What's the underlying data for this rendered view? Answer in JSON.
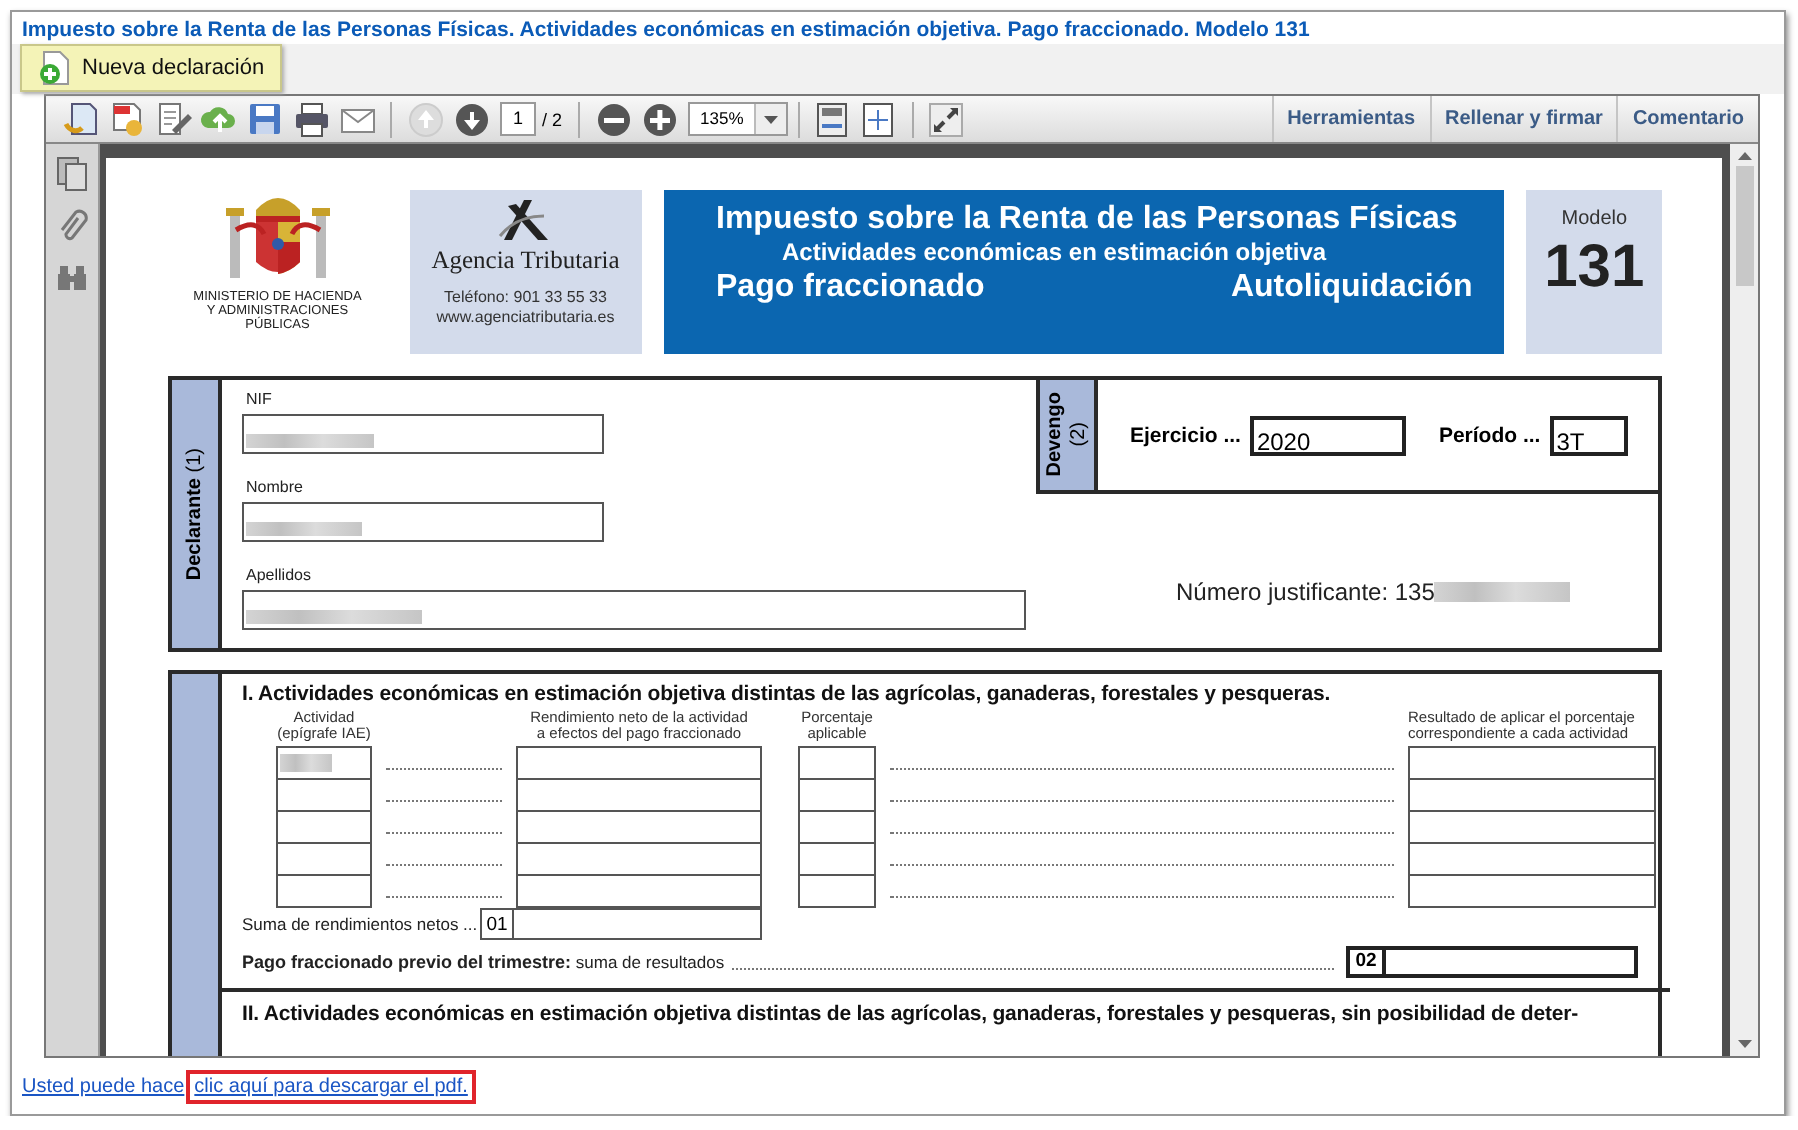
{
  "window": {
    "title": "Impuesto sobre la Renta de las Personas Físicas. Actividades económicas en estimación objetiva. Pago fraccionado. Modelo 131"
  },
  "tooltip_button": {
    "label": "Nueva declaración"
  },
  "toolbar": {
    "page": "1",
    "page_total": "/ 2",
    "zoom": "135%",
    "panels": [
      "Herramientas",
      "Rellenar y firmar",
      "Comentario"
    ]
  },
  "document": {
    "header": {
      "ministry_lines": [
        "MINISTERIO DE HACIENDA",
        "Y ADMINISTRACIONES",
        "PÚBLICAS"
      ],
      "agency": "Agencia Tributaria",
      "phone": "Teléfono: 901 33 55 33",
      "web": "www.agenciatributaria.es",
      "banner_title": "Impuesto sobre la Renta de las Personas Físicas",
      "banner_subtitle": "Actividades económicas en estimación objetiva",
      "banner_left": "Pago fraccionado",
      "banner_right": "Autoliquidación",
      "model_label": "Modelo",
      "model_number": "131"
    },
    "declarante": {
      "label": "**Declarante** (1)",
      "fields": [
        {
          "label": "NIF",
          "redacted": true
        },
        {
          "label": "Nombre",
          "redacted": true
        },
        {
          "label": "Apellidos",
          "redacted": true
        }
      ],
      "devengo": {
        "label": "Devengo",
        "note": "(2)",
        "ejercicio_label": "Ejercicio ...",
        "ejercicio": "2020",
        "periodo_label": "Período ...",
        "periodo": "3T"
      },
      "justificante_label": "Número justificante: 135",
      "justificante_redacted": true
    },
    "section_1": {
      "title": "I.  Actividades económicas en estimación objetiva distintas de las agrícolas, ganaderas, forestales y pesqueras.",
      "col_activity": "Actividad\n(epígrafe IAE)",
      "col_rendimiento": "Rendimiento neto de la actividad\na efectos del pago fraccionado",
      "col_porcentaje": "Porcentaje\naplicable",
      "col_resultado": "Resultado de aplicar el porcentaje\ncorrespondiente a cada actividad",
      "rows": [
        {
          "redacted": true
        },
        {
          "redacted": false
        },
        {
          "redacted": false
        },
        {
          "redacted": false
        },
        {
          "redacted": false
        }
      ],
      "suma_label": "Suma de rendimientos netos ...",
      "suma_box": "01",
      "previo_label": "**Pago fraccionado previo del trimestre:** suma de resultados",
      "previo_box": "02"
    },
    "section_2": {
      "title": "II.  Actividades económicas en estimación objetiva distintas de las agrícolas, ganaderas, forestales y pesqueras, sin posibilidad de deter-"
    }
  },
  "footer": {
    "text": "Usted puede hace",
    "link": "clic aquí para descargar el pdf."
  }
}
